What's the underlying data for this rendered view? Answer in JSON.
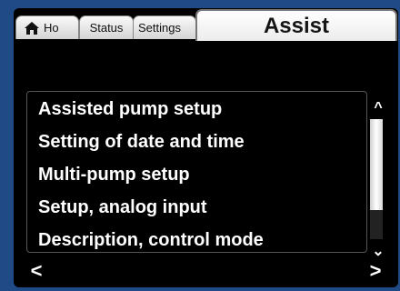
{
  "tabs": {
    "home_label": "Ho",
    "status_label": "Status",
    "settings_label": "Settings",
    "assist_label": "Assist",
    "active": "Assist"
  },
  "menu": {
    "items": [
      {
        "label": "Assisted pump setup"
      },
      {
        "label": "Setting of date and time"
      },
      {
        "label": "Multi-pump setup"
      },
      {
        "label": "Setup, analog input"
      },
      {
        "label": "Description, control mode"
      }
    ]
  },
  "scrollbar": {
    "up_icon": "chevron-up-icon",
    "down_icon": "chevron-down-icon",
    "thumb_fraction": 0.76,
    "thumb_position": 0
  },
  "navigation": {
    "left_icon": "chevron-left-icon",
    "right_icon": "chevron-right-icon",
    "left_glyph": "<",
    "right_glyph": ">"
  },
  "colors": {
    "frame": "#1f4a86",
    "screen": "#000000",
    "tab_background": "#ececec"
  }
}
